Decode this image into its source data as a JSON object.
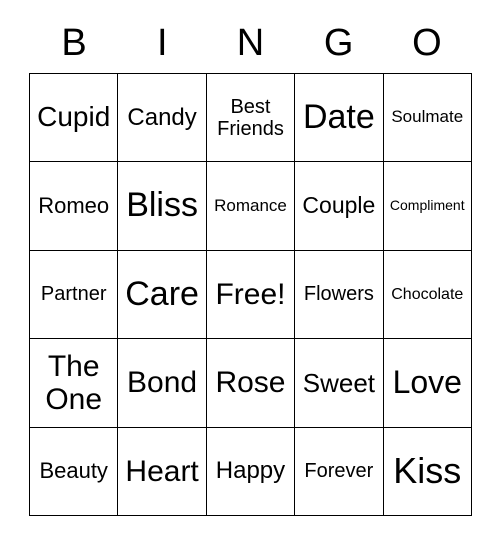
{
  "header": [
    "B",
    "I",
    "N",
    "G",
    "O"
  ],
  "cells": [
    {
      "t": "Cupid",
      "s": 28
    },
    {
      "t": "Candy",
      "s": 24
    },
    {
      "t": "Best Friends",
      "s": 20
    },
    {
      "t": "Date",
      "s": 34
    },
    {
      "t": "Soulmate",
      "s": 17
    },
    {
      "t": "Romeo",
      "s": 22
    },
    {
      "t": "Bliss",
      "s": 34
    },
    {
      "t": "Romance",
      "s": 17
    },
    {
      "t": "Couple",
      "s": 23
    },
    {
      "t": "Compliment",
      "s": 14
    },
    {
      "t": "Partner",
      "s": 20
    },
    {
      "t": "Care",
      "s": 34
    },
    {
      "t": "Free!",
      "s": 30
    },
    {
      "t": "Flowers",
      "s": 20
    },
    {
      "t": "Chocolate",
      "s": 16
    },
    {
      "t": "The One",
      "s": 30
    },
    {
      "t": "Bond",
      "s": 30
    },
    {
      "t": "Rose",
      "s": 30
    },
    {
      "t": "Sweet",
      "s": 26
    },
    {
      "t": "Love",
      "s": 32
    },
    {
      "t": "Beauty",
      "s": 22
    },
    {
      "t": "Heart",
      "s": 30
    },
    {
      "t": "Happy",
      "s": 24
    },
    {
      "t": "Forever",
      "s": 20
    },
    {
      "t": "Kiss",
      "s": 36
    }
  ]
}
